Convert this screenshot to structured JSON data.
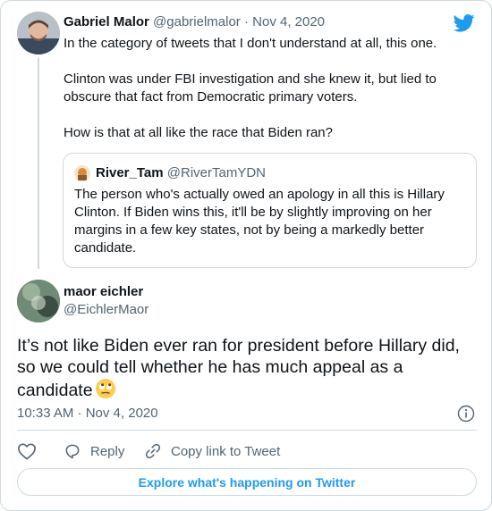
{
  "parent_tweet": {
    "name": "Gabriel Malor",
    "handle": "@gabrielmalor",
    "separator": "·",
    "date": "Nov 4, 2020",
    "paragraphs": [
      "In the category of tweets that I don't understand at all, this one.",
      "Clinton was under FBI investigation and she knew it, but lied to obscure that fact from Democratic primary voters.",
      "How is that at all like the race that Biden ran?"
    ]
  },
  "quoted_tweet": {
    "name": "River_Tam",
    "handle": "@RiverTamYDN",
    "text": "The person who's actually owed an apology in all this is Hillary Clinton. If Biden wins this, it'll be by slightly improving on her margins in a few key states, not by being a markedly better candidate."
  },
  "main_tweet": {
    "name": "maor eichler",
    "handle": "@EichlerMaor",
    "text": "It’s not like Biden ever ran for president before Hillary did, so we could tell whether he has much appeal as a candidate",
    "emoji": "face-with-rolling-eyes",
    "timestamp": "10:33 AM · Nov 4, 2020"
  },
  "actions": {
    "reply_label": "Reply",
    "copy_link_label": "Copy link to Tweet"
  },
  "explore_label": "Explore what's happening on Twitter",
  "colors": {
    "brand_blue": "#1d9bf0",
    "text": "#0f1419",
    "muted": "#536471",
    "border": "#cfd9de"
  }
}
